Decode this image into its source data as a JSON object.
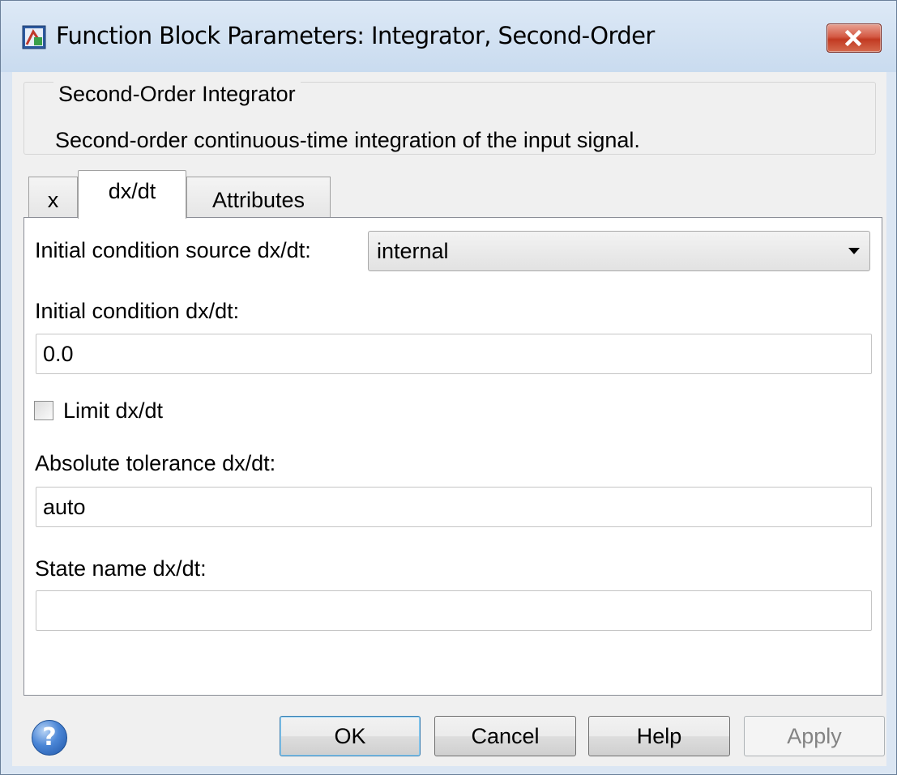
{
  "window": {
    "title": "Function Block Parameters: Integrator, Second-Order",
    "icon": "simulink-block-icon",
    "close_icon": "close-icon"
  },
  "group": {
    "title": "Second-Order Integrator",
    "description": "Second-order continuous-time integration of the input signal."
  },
  "tabs": [
    {
      "label": "x",
      "active": false
    },
    {
      "label": "dx/dt",
      "active": true
    },
    {
      "label": "Attributes",
      "active": false
    }
  ],
  "form": {
    "ic_source_label": "Initial condition source dx/dt:",
    "ic_source_value": "internal",
    "ic_label": "Initial condition dx/dt:",
    "ic_value": "0.0",
    "limit_label": "Limit dx/dt",
    "limit_checked": false,
    "abstol_label": "Absolute tolerance dx/dt:",
    "abstol_value": "auto",
    "statename_label": "State name dx/dt:",
    "statename_value": ""
  },
  "buttons": {
    "help_glyph": "?",
    "ok": "OK",
    "cancel": "Cancel",
    "help": "Help",
    "apply": "Apply"
  },
  "colors": {
    "title_bar": "#c9dbef",
    "close_button": "#c9452f",
    "help_icon": "#3d7bd0"
  }
}
